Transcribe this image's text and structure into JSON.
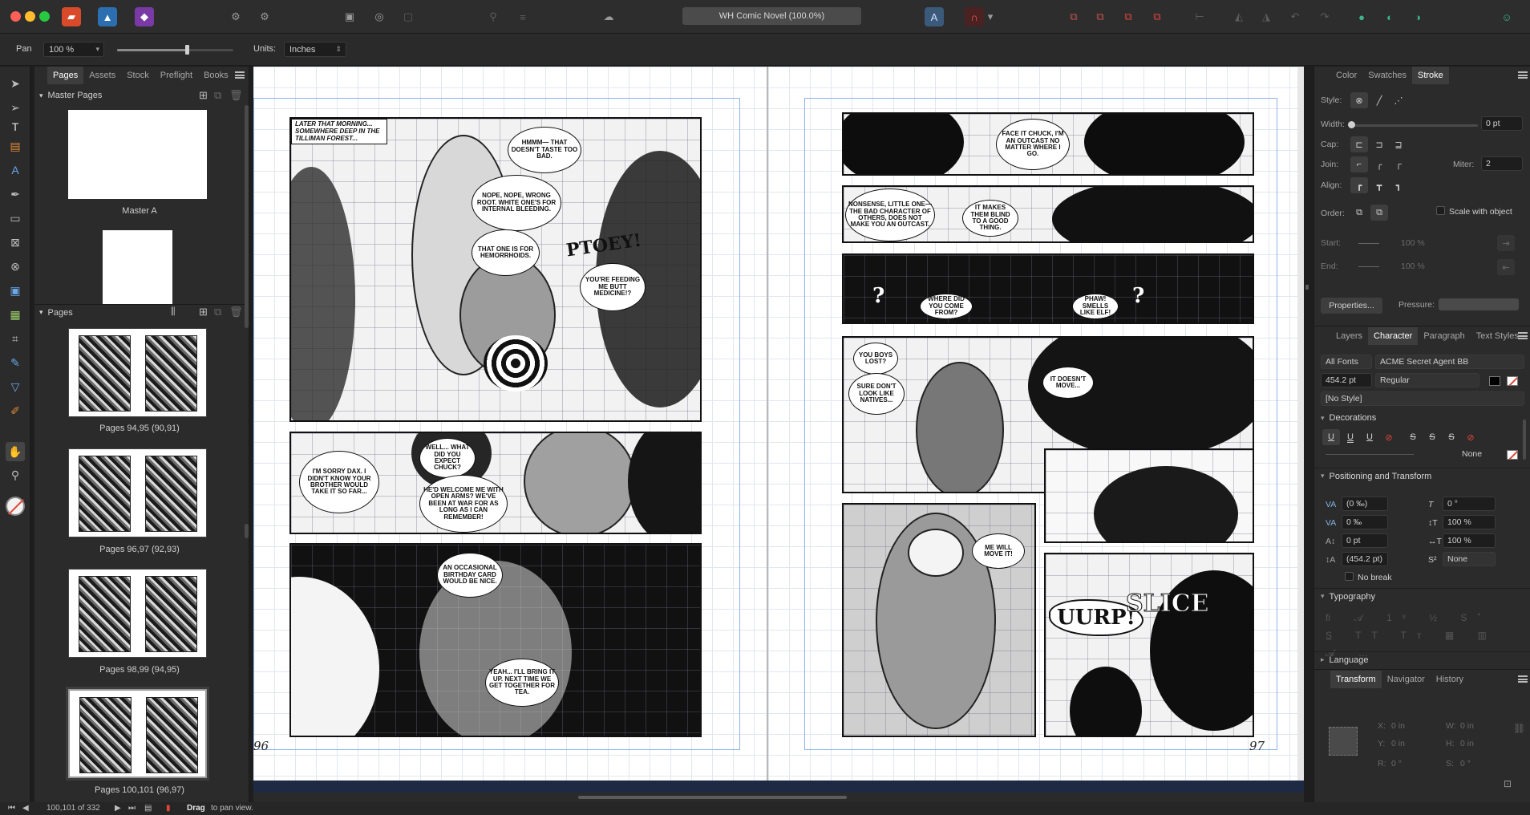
{
  "document": {
    "title": "WH Comic Novel (100.0%)"
  },
  "context_toolbar": {
    "tool_name": "Pan",
    "zoom_value": "100 %",
    "zoom_level": 0.6,
    "units_label": "Units:",
    "units_value": "Inches"
  },
  "pages_panel": {
    "tabs": [
      "Pages",
      "Assets",
      "Stock",
      "Preflight",
      "Books"
    ],
    "active_tab": "Pages",
    "master_pages_header": "Master Pages",
    "master_label": "Master A",
    "pages_header": "Pages",
    "spreads": [
      {
        "label": "Pages 94,95 (90,91)"
      },
      {
        "label": "Pages 96,97 (92,93)"
      },
      {
        "label": "Pages 98,99 (94,95)"
      },
      {
        "label": "Pages 100,101 (96,97)"
      }
    ]
  },
  "canvas": {
    "left_page_number": "96",
    "right_page_number": "97",
    "left_page": {
      "caption_1": "LATER THAT MORNING... SOMEWHERE DEEP IN THE TILLIMAN FOREST...",
      "bubble_1": "HMMM— THAT DOESN'T TASTE TOO BAD.",
      "bubble_2": "NOPE, NOPE, WRONG ROOT. WHITE ONE'S FOR INTERNAL BLEEDING.",
      "bubble_3": "THAT ONE IS FOR HEMORRHOIDS.",
      "sfx_1": "PTOEY!",
      "bubble_4": "YOU'RE FEEDING ME BUTT MEDICINE!?",
      "bubble_5": "I'M SORRY DAX. I DIDN'T KNOW YOUR BROTHER WOULD TAKE IT SO FAR...",
      "bubble_6": "WELL... WHAT DID YOU EXPECT CHUCK?",
      "bubble_7": "HE'D WELCOME ME WITH OPEN ARMS? WE'VE BEEN AT WAR FOR AS LONG AS I CAN REMEMBER!",
      "bubble_8": "AN OCCASIONAL BIRTHDAY CARD WOULD BE NICE.",
      "bubble_9": "YEAH... I'LL BRING IT UP. NEXT TIME WE GET TOGETHER FOR TEA."
    },
    "right_page": {
      "bubble_1": "FACE IT CHUCK, I'M AN OUTCAST NO MATTER WHERE I GO.",
      "bubble_2": "NONSENSE, LITTLE ONE—THE BAD CHARACTER OF OTHERS, DOES NOT MAKE YOU AN OUTCAST.",
      "bubble_3": "IT MAKES THEM BLIND TO A GOOD THING.",
      "bubble_4": "WHERE DID YOU COME FROM?",
      "bubble_5": "PHAW! SMELLS LIKE ELF!",
      "bubble_6": "YOU BOYS LOST?",
      "bubble_7": "SURE DON'T LOOK LIKE NATIVES...",
      "bubble_8": "IT DOESN'T MOVE...",
      "bubble_9": "ME WILL MOVE IT!",
      "sfx_1": "UURP!",
      "sfx_2": "SLICE"
    }
  },
  "stroke_panel": {
    "tabs": [
      "Color",
      "Swatches",
      "Stroke"
    ],
    "active_tab": "Stroke",
    "style_label": "Style:",
    "width_label": "Width:",
    "width_value": "0 pt",
    "cap_label": "Cap:",
    "join_label": "Join:",
    "miter_label": "Miter:",
    "miter_value": "2",
    "align_label": "Align:",
    "order_label": "Order:",
    "scale_label": "Scale with object",
    "start_label": "Start:",
    "start_value": "100 %",
    "end_label": "End:",
    "end_value": "100 %",
    "properties_button": "Properties...",
    "pressure_label": "Pressure:"
  },
  "character_panel": {
    "tabs": [
      "Layers",
      "Character",
      "Paragraph",
      "Text Styles"
    ],
    "active_tab": "Character",
    "font_collection": "All Fonts",
    "font_family": "ACME Secret Agent BB",
    "font_size": "454.2 pt",
    "font_style": "Regular",
    "text_style": "[No Style]",
    "decorations_header": "Decorations",
    "decoration_none": "None",
    "positioning_header": "Positioning and Transform",
    "tracking": "(0 ‰)",
    "kerning": "0 ‰",
    "baseline": "0 pt",
    "leading": "(454.2 pt)",
    "skew": "0 °",
    "vscale": "100 %",
    "hscale": "100 %",
    "script": "None",
    "no_break": "No break",
    "typography_header": "Typography",
    "language_header": "Language"
  },
  "transform_panel": {
    "tabs": [
      "Transform",
      "Navigator",
      "History"
    ],
    "active_tab": "Transform",
    "x_label": "X:",
    "x_value": "0 in",
    "y_label": "Y:",
    "y_value": "0 in",
    "w_label": "W:",
    "w_value": "0 in",
    "h_label": "H:",
    "h_value": "0 in",
    "r_label": "R:",
    "r_value": "0 °",
    "s_label": "S:",
    "s_value": "0 °"
  },
  "status_bar": {
    "page_indicator": "100,101 of 332",
    "hint_bold": "Drag",
    "hint_text": "to pan view."
  },
  "colors": {
    "accent_red": "#e0463a",
    "affinity_publisher": "#d94a2b",
    "affinity_designer": "#2b6fb0",
    "affinity_photo": "#7a3aa6",
    "guide_blue": "#8fb4e8"
  }
}
